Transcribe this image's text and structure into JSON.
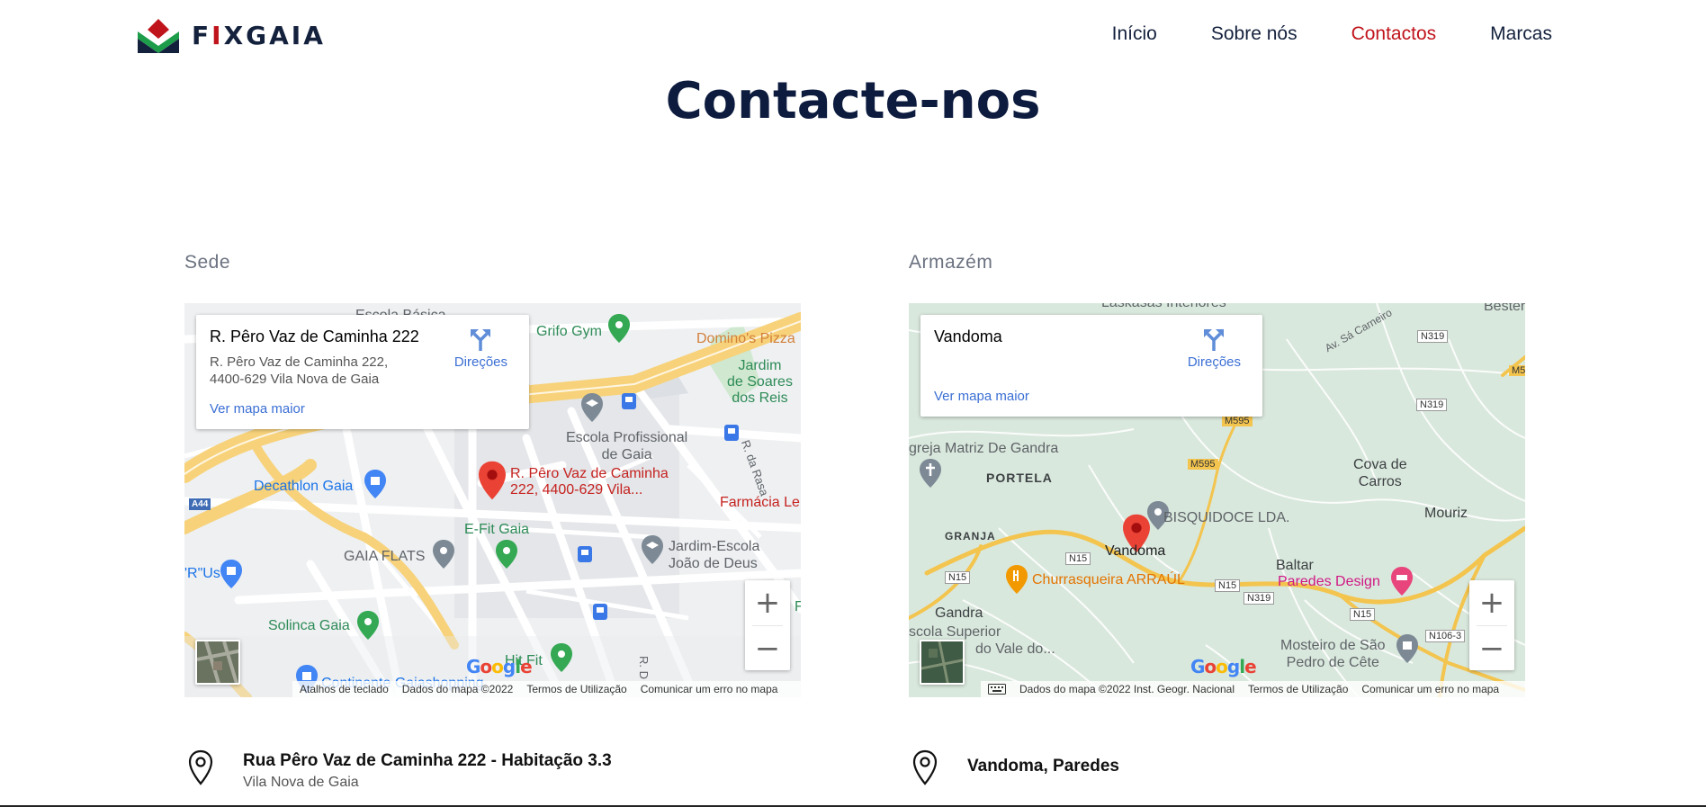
{
  "header": {
    "logo_text_a": "F",
    "logo_text_accent": "I",
    "logo_text_b": "XGAIA",
    "nav": [
      {
        "label": "Início",
        "active": false
      },
      {
        "label": "Sobre nós",
        "active": false
      },
      {
        "label": "Contactos",
        "active": true
      },
      {
        "label": "Marcas",
        "active": false
      }
    ]
  },
  "page_title": "Contacte-nos",
  "sede": {
    "label": "Sede",
    "map": {
      "card_title": "R. Pêro Vaz de Caminha 222",
      "card_address": "R. Pêro Vaz de Caminha 222, 4400-629 Vila Nova de Gaia",
      "directions": "Direções",
      "larger_map": "Ver mapa maior",
      "marker_label_1": "R. Pêro Vaz de Caminha",
      "marker_label_2": "222, 4400-629 Vila...",
      "places": {
        "escola_basica": "Escola Básica",
        "grifo_gym": "Grifo Gym",
        "dominos": "Domino's Pizza",
        "jardim_soares_1": "Jardim",
        "jardim_soares_2": "de Soares",
        "jardim_soares_3": "dos Reis",
        "escola_prof_1": "Escola Profissional",
        "escola_prof_2": "de Gaia",
        "r_da_rasa": "R. da Rasa",
        "decathlon": "Decathlon Gaia",
        "farmacia": "Farmácia Le",
        "efit": "E-Fit Gaia",
        "gaia_flats": "GAIA FLATS",
        "jardim_escola_1": "Jardim-Escola",
        "jardim_escola_2": "João de Deus",
        "rus": "'R\"Us",
        "solinca": "Solinca Gaia",
        "continente": "Continente Gaiashopping",
        "hit_fit": "Hit Fit",
        "a44": "A44",
        "r_d": "R. D",
        "f": "F"
      },
      "attribution": [
        "Atalhos de teclado",
        "Dados do mapa ©2022",
        "Termos de Utilização",
        "Comunicar um erro no mapa"
      ]
    },
    "address_main": "Rua Pêro Vaz de Caminha 222 - Habitação 3.3",
    "address_sub": "Vila Nova de Gaia"
  },
  "armazem": {
    "label": "Armazém",
    "map": {
      "card_title": "Vandoma",
      "directions": "Direções",
      "larger_map": "Ver mapa maior",
      "places": {
        "laskasas": "Laskasas Interiores",
        "bester": "Bester",
        "av_sa_carneiro": "Av. Sá Carneiro",
        "n319a": "N319",
        "m5": "M5",
        "n319b": "N319",
        "m595a": "M595",
        "igreja": "greja Matriz De Gandra",
        "portela": "PORTELA",
        "m595b": "M595",
        "cova_1": "Cova de",
        "cova_2": "Carros",
        "mouriz": "Mouriz",
        "granja": "GRANJA",
        "bisquidoce": "BISQUIDOCE LDA.",
        "vandoma": "Vandoma",
        "n15a": "N15",
        "n15b": "N15",
        "baltar": "Baltar",
        "churrasqueira": "Churrasqueira ARRAÚL",
        "paredes_design": "Paredes Design",
        "n15c": "N15",
        "n319c": "N319",
        "n15d": "N15",
        "n106": "N106-3",
        "gandra": "Gandra",
        "escola_superior": "scola Superior",
        "vale_do": "do Vale do...",
        "mosteiro_1": "Mosteiro de São",
        "mosteiro_2": "Pedro de Cête"
      },
      "attribution": [
        "Dados do mapa ©2022 Inst. Geogr. Nacional",
        "Termos de Utilização",
        "Comunicar um erro no mapa"
      ]
    },
    "address_main": "Vandoma, Paredes"
  },
  "google_logo": "Google"
}
